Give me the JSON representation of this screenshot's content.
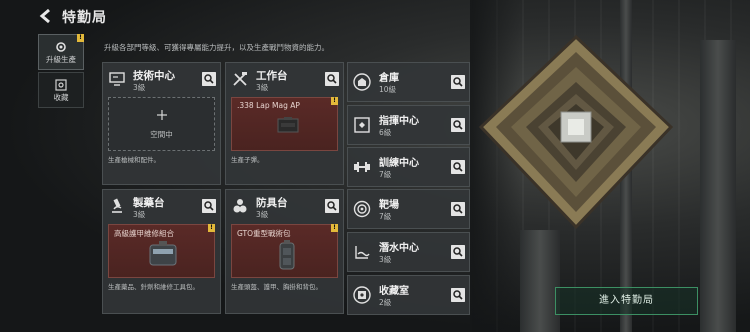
{
  "header": {
    "title": "特勤局"
  },
  "subtitle": "升級各部門等級、可獲得專屬能力提升，以及生產戰鬥物資的能力。",
  "side_tabs": [
    {
      "label": "升級生產",
      "active": true,
      "badge": "!"
    },
    {
      "label": "收藏",
      "active": false
    }
  ],
  "large_cards": [
    {
      "name": "技術中心",
      "level": "3級",
      "slot_text": "空間中",
      "description": "生產槍械和配件。",
      "icon": "monitor-icon"
    },
    {
      "name": "工作台",
      "level": "3級",
      "item_name": ".338 Lap Mag AP",
      "description": "生產子彈。",
      "icon": "tools-icon",
      "badge": "!"
    },
    {
      "name": "製藥台",
      "level": "3級",
      "item_name": "高級護甲維修組合",
      "description": "生產藥品、針劑和維修工具包。",
      "icon": "microscope-icon",
      "badge": "!"
    },
    {
      "name": "防具台",
      "level": "3級",
      "item_name": "GTO重型戰術包",
      "description": "生產頭盔、護甲、胸掛和背包。",
      "icon": "armor-icon",
      "badge": "!"
    }
  ],
  "small_cards": [
    {
      "name": "倉庫",
      "level": "10級",
      "icon": "warehouse-icon"
    },
    {
      "name": "指揮中心",
      "level": "6級",
      "icon": "command-icon"
    },
    {
      "name": "訓練中心",
      "level": "7級",
      "icon": "dumbbell-icon"
    },
    {
      "name": "靶場",
      "level": "7級",
      "icon": "target-icon"
    },
    {
      "name": "潛水中心",
      "level": "3級",
      "icon": "dive-icon"
    },
    {
      "name": "收藏室",
      "level": "2級",
      "icon": "vault-icon"
    }
  ],
  "enter_button": {
    "label": "進入特勤局"
  },
  "colors": {
    "accent_green": "#3c8f63",
    "badge_yellow": "#e3b93a",
    "slot_red": "#5a2a27"
  }
}
